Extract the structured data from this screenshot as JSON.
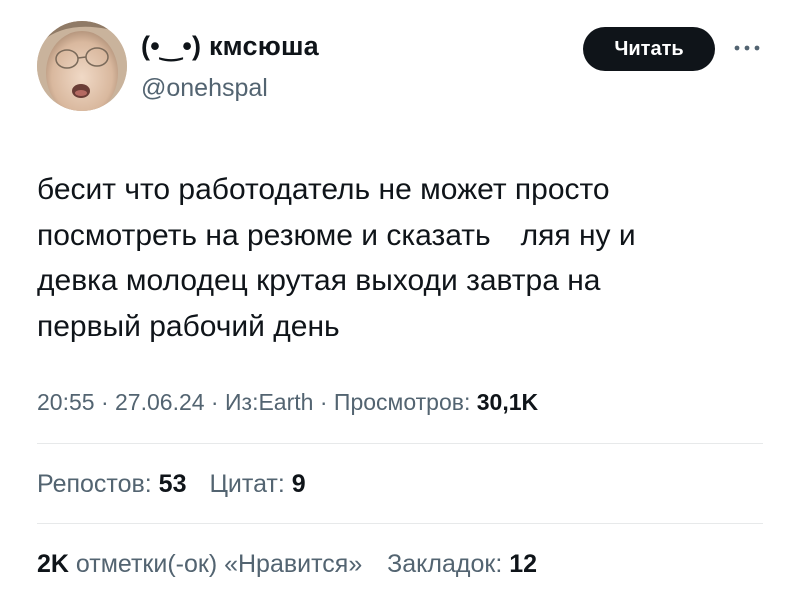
{
  "tweet": {
    "author": {
      "display_name": "(•‿•) кмсюша",
      "handle": "@onehspal",
      "avatar": "avatar-photo"
    },
    "follow_label": "Читать",
    "more_icon": "more-horizontal-icon",
    "text_lines": [
      "бесит что работодатель не может просто",
      "посмотреть на резюме и сказать",
      "ляя ну и",
      "девка молодец крутая выходи завтра на",
      "первый рабочий день"
    ],
    "meta": {
      "time": "20:55",
      "separator": " · ",
      "date": "27.06.24",
      "source": "Из:Earth",
      "views_label": "Просмотров: ",
      "views_value": "30,1K"
    },
    "stats": {
      "reposts_value": "53",
      "reposts_label": "Репостов: ",
      "quotes_value": "9",
      "quotes_label": "Цитат: ",
      "likes_value": "2K",
      "likes_label": " отметки(-ок) «Нравится»",
      "bookmarks_value": "12",
      "bookmarks_label": "Закладок: "
    }
  }
}
